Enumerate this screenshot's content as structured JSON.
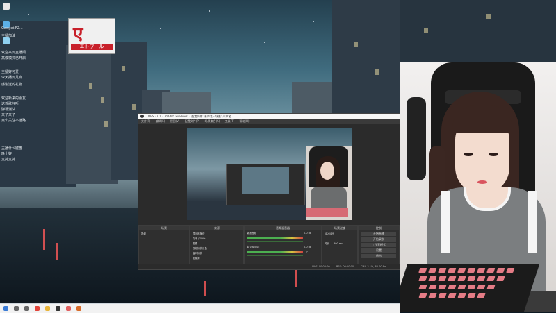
{
  "desktop": {
    "sign": {
      "glyph": "ए",
      "subtitle": "エトワール"
    },
    "chat_messages": [
      "Gadget.F2...",
      "主播加油",
      "欢迎来到直播间",
      "高级模式已开启",
      "主播好可爱",
      "今天播到几点",
      "感谢送的礼物",
      "欢迎新来的朋友",
      "这首歌好听",
      "弹幕测试",
      "来了来了",
      "点个关注不迷路",
      "主播什么键盘",
      "晚上好",
      "支持支持"
    ]
  },
  "taskbar": {
    "icons": [
      "windows-start",
      "search",
      "task-view",
      "browser",
      "folder",
      "obs",
      "chat-app",
      "music"
    ],
    "colors": [
      "#3a7bd5",
      "#666666",
      "#666666",
      "#e0443a",
      "#e8b43a",
      "#333333",
      "#e06060",
      "#d86b2a"
    ]
  },
  "obs": {
    "title": "OBS 27.1.3 (64-bit, windows) - 配置文件: 未命名 - 场景: 未命名",
    "menu": [
      "文件(F)",
      "编辑(E)",
      "视图(V)",
      "配置文件(P)",
      "场景集合(S)",
      "工具(T)",
      "帮助(H)"
    ],
    "docks": {
      "scenes": {
        "title": "场景",
        "items": [
          "场景"
        ]
      },
      "sources": {
        "title": "来源",
        "items": [
          "显示器捕获",
          "文本 (GDI+)",
          "图像",
          "视频捕获设备",
          "窗口捕获",
          "图像源"
        ]
      },
      "mixer": {
        "title": "音频混音器",
        "channels": [
          "桌面音频",
          "麦克风/Aux"
        ],
        "values": [
          "0.0 dB",
          "0.0 dB"
        ]
      },
      "transitions": {
        "title": "场景过渡",
        "type": "淡入淡出",
        "duration_label": "时长",
        "duration": "300 ms"
      },
      "controls": {
        "title": "控制",
        "buttons": [
          "开始直播",
          "开始录制",
          "工作室模式",
          "设置",
          "退出"
        ]
      }
    },
    "status": {
      "live": "LIVE: 00:00:00",
      "rec": "REC: 00:00:00",
      "cpu": "CPU: 3.1%, 60.00 fps"
    }
  }
}
